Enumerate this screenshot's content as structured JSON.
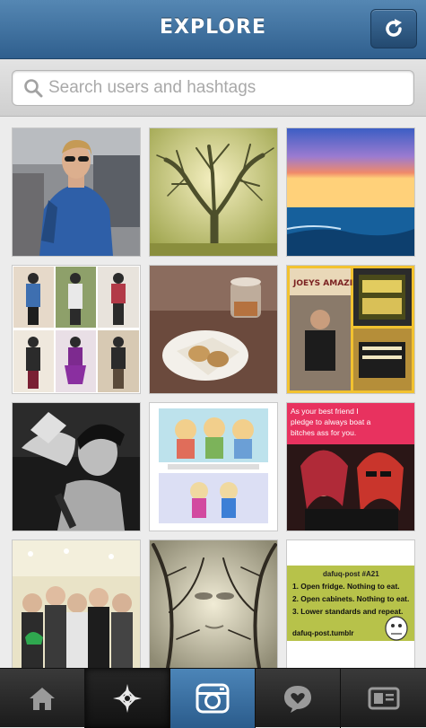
{
  "header": {
    "title": "EXPLORE",
    "refresh_icon": "refresh-icon"
  },
  "search": {
    "placeholder": "Search users and hashtags",
    "icon": "search-icon"
  },
  "tiles": [
    {
      "name": "man-with-sunglasses-photo"
    },
    {
      "name": "foggy-tree-photo"
    },
    {
      "name": "sunset-sea-photo"
    },
    {
      "name": "outfit-collage-photo"
    },
    {
      "name": "cookies-and-jar-photo"
    },
    {
      "name": "joeys-amazing-race-collage"
    },
    {
      "name": "bw-singer-photo"
    },
    {
      "name": "cartoon-comic-photo"
    },
    {
      "name": "best-friend-meme"
    },
    {
      "name": "group-selfie-photo"
    },
    {
      "name": "tree-face-photo"
    },
    {
      "name": "dafuq-post-meme"
    }
  ],
  "meme_best_friend": {
    "text": "As your best friend I pledge to always boat a bitches ass for you."
  },
  "meme_dafuq": {
    "heading": "dafuq-post #A21",
    "line1": "1. Open fridge. Nothing to eat.",
    "line2": "2. Open cabinets. Nothing to eat.",
    "line3": "3. Lower standards and repeat.",
    "footer": "dafuq-post.tumblr"
  },
  "joeys_collage": {
    "sign_text": "JOEYS AMAZING"
  },
  "tabbar": {
    "items": [
      {
        "icon": "home-icon"
      },
      {
        "icon": "explore-star-icon"
      },
      {
        "icon": "camera-icon"
      },
      {
        "icon": "activity-heart-bubble-icon"
      },
      {
        "icon": "profile-card-icon"
      }
    ]
  },
  "colors": {
    "header_top": "#5587b3",
    "header_bottom": "#2f5f8e",
    "camera_tab": "#3f76a8",
    "meme_banner": "#e8325f",
    "dafuq_bg": "#b7c24a"
  }
}
